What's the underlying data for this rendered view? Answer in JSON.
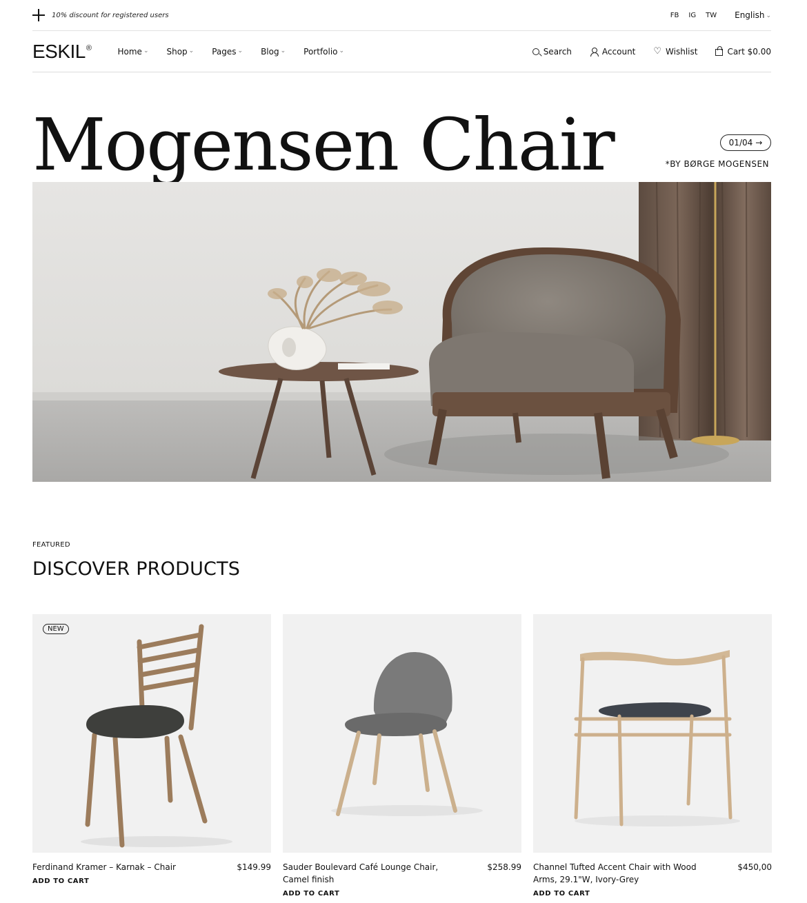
{
  "topbar": {
    "promo": "10% discount for registered users",
    "socials": [
      "FB",
      "IG",
      "TW"
    ],
    "language": "English"
  },
  "nav": {
    "logo": "ESKIL",
    "logo_mark": "®",
    "menu": [
      "Home",
      "Shop",
      "Pages",
      "Blog",
      "Portfolio"
    ],
    "search": "Search",
    "account": "Account",
    "wishlist": "Wishlist",
    "cart": "Cart $0.00"
  },
  "hero": {
    "title": "Mogensen Chair",
    "pager": "01/04",
    "byline": "*BY BØRGE MOGENSEN"
  },
  "featured": {
    "eyebrow": "FEATURED",
    "title": "DISCOVER PRODUCTS",
    "products": [
      {
        "badge": "NEW",
        "name": "Ferdinand Kramer – Karnak – Chair",
        "price": "$149.99",
        "cta": "ADD TO CART"
      },
      {
        "badge": "",
        "name": "Sauder Boulevard Café Lounge Chair, Camel finish",
        "price": "$258.99",
        "cta": "ADD TO CART"
      },
      {
        "badge": "",
        "name": "Channel Tufted Accent Chair with Wood Arms, 29.1\"W, Ivory-Grey",
        "price": "$450,00",
        "cta": "ADD TO CART"
      }
    ]
  }
}
